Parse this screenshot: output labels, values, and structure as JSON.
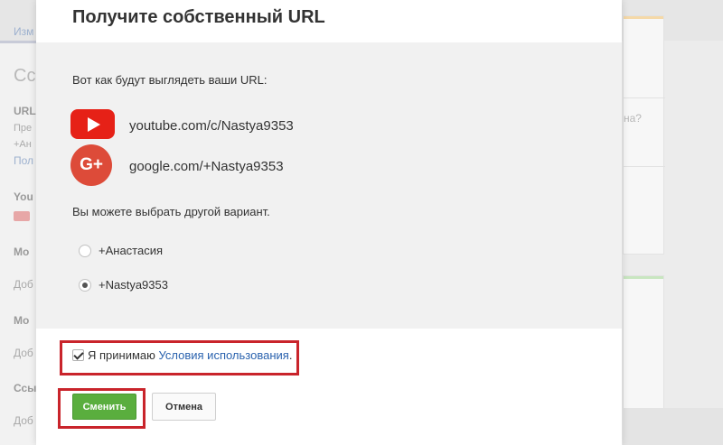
{
  "background": {
    "left_texts": {
      "link_top": "Изм",
      "heading": "Сс",
      "url_label": "URL",
      "line1": "Пре",
      "line2": "+Ан",
      "link": "Пол",
      "youtube_label": "You",
      "section1": "Мо",
      "add1": "Доб",
      "section2": "Мо",
      "add2": "Доб",
      "section3": "Ссы",
      "add3": "Доб"
    },
    "right_texts": {
      "question": "на?"
    },
    "colors": {
      "card1_stripe": "#f5d9a8",
      "card2_stripe": "#c8e6c0"
    }
  },
  "dialog": {
    "title": "Получите собственный URL",
    "intro": "Вот как будут выглядеть ваши URL:",
    "urls": [
      {
        "icon": "youtube-icon",
        "text": "youtube.com/c/Nastya9353"
      },
      {
        "icon": "google-plus-icon",
        "icon_text": "G+",
        "text": "google.com/+Nastya9353"
      }
    ],
    "hint": "Вы можете выбрать другой вариант.",
    "options": [
      {
        "label": "+Анастасия",
        "selected": false
      },
      {
        "label": "+Nastya9353",
        "selected": true
      }
    ],
    "agreement": {
      "checked": true,
      "text": "Я принимаю",
      "link": "Условия использования",
      "suffix": "."
    },
    "buttons": {
      "primary": "Сменить",
      "secondary": "Отмена"
    },
    "colors": {
      "primary_button": "#5aae3e",
      "link": "#2a62ae",
      "highlight": "#c9242b",
      "youtube": "#e62117",
      "google_plus": "#dd4b39"
    }
  }
}
